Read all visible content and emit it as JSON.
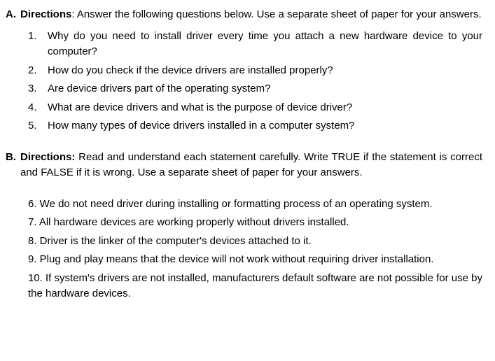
{
  "sectionA": {
    "label": "A.",
    "directionsLabel": "Directions",
    "directionsText": ": Answer the following questions below.  Use a separate sheet of paper for your answers.",
    "questions": [
      {
        "num": "1.",
        "text": "Why do you need to install driver every time you attach a new hardware device to your computer?"
      },
      {
        "num": "2.",
        "text": "How do you check if the device drivers are installed properly?"
      },
      {
        "num": "3.",
        "text": "Are device drivers part of the operating system?"
      },
      {
        "num": "4.",
        "text": "What are device drivers and what is the purpose of device driver?"
      },
      {
        "num": "5.",
        "text": "How many types of device drivers installed in a computer system?"
      }
    ]
  },
  "sectionB": {
    "label": "B.",
    "directionsLabel": "Directions:",
    "directionsText": " Read and understand each statement carefully. Write TRUE if the statement is correct and FALSE if it is wrong. Use a separate sheet of paper for your answers.",
    "items": [
      "6. We do not need driver during installing or formatting process of an operating system.",
      "7. All hardware devices are working properly without drivers installed.",
      "8. Driver is the linker of the computer's devices attached to it.",
      "9. Plug and play means that the device will not work without requiring driver installation.",
      "10. If system's drivers are not installed, manufacturers default software are not possible for use by the hardware devices."
    ]
  }
}
